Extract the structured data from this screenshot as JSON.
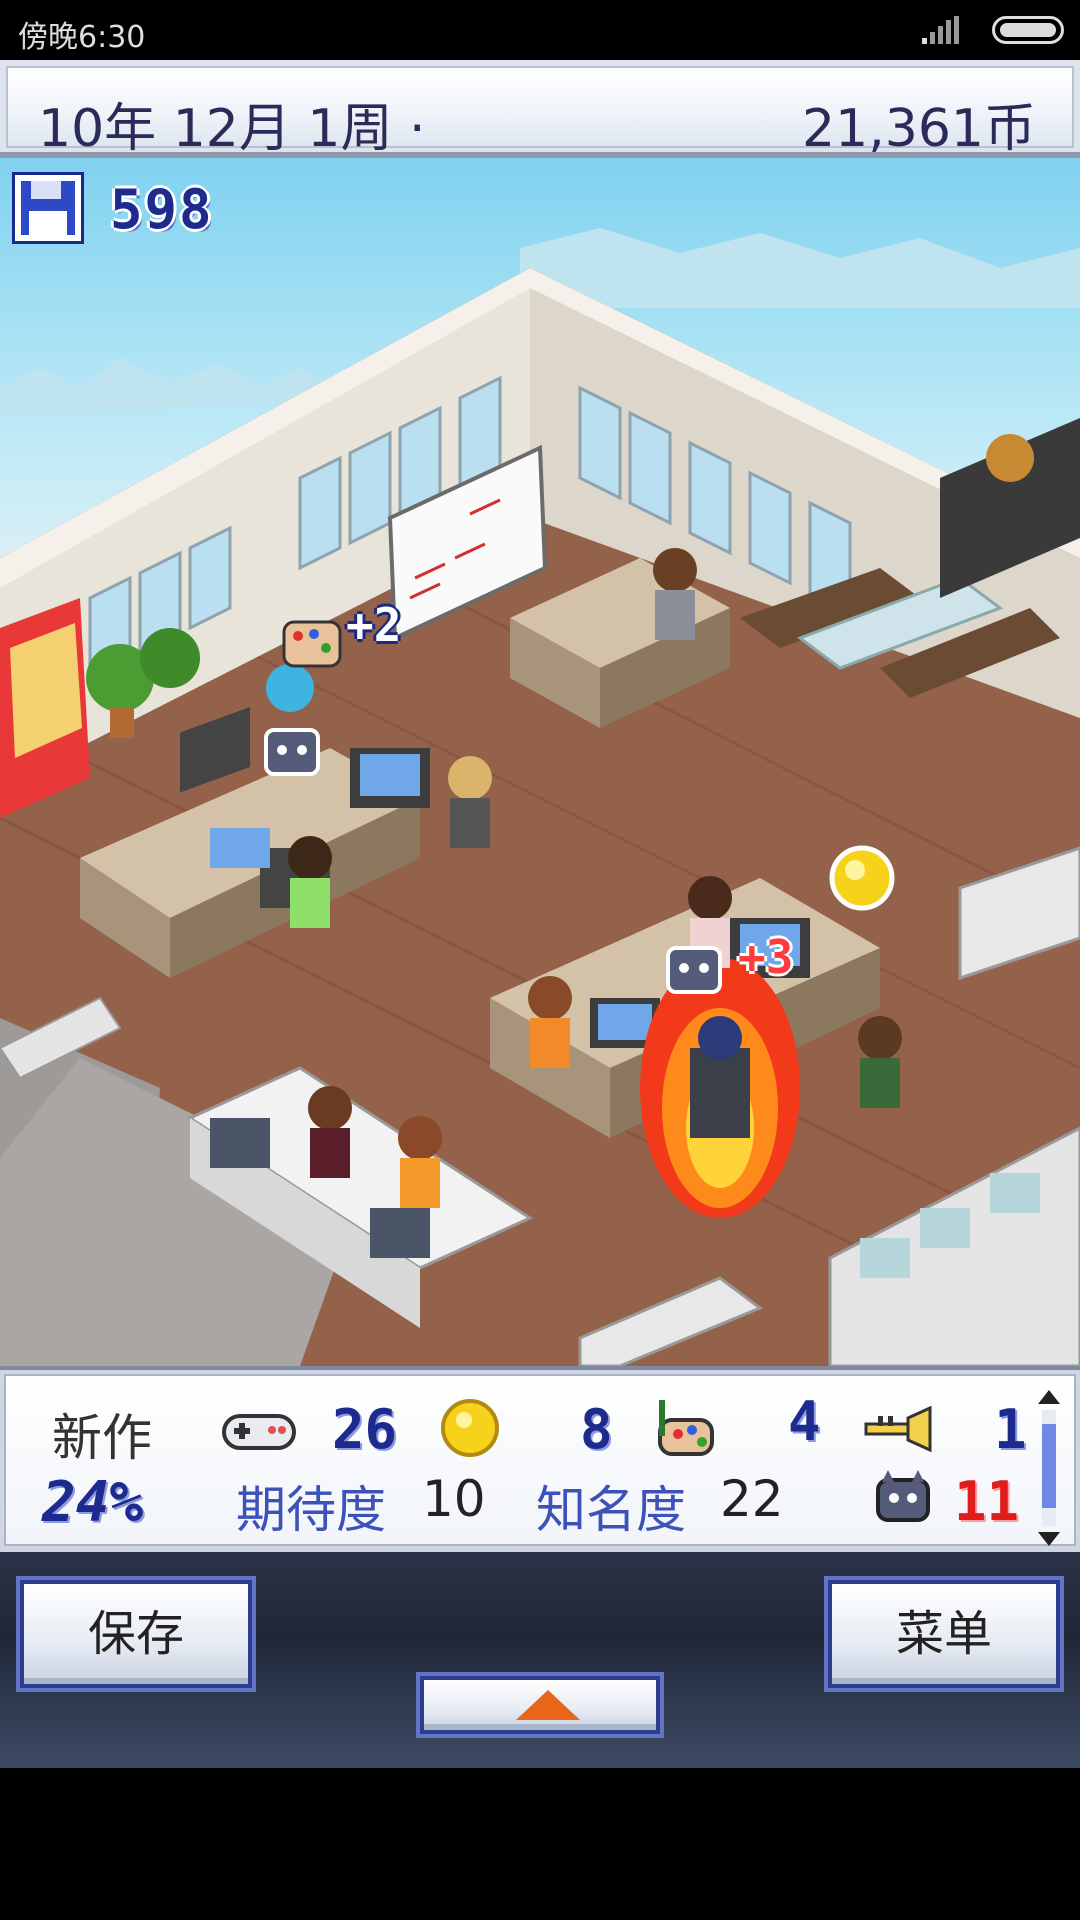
{
  "status_bar": {
    "time": "傍晚6:30"
  },
  "top_bar": {
    "date": "10年 12月 1周 ·",
    "money": "21,361币"
  },
  "scene": {
    "disk_count": "598",
    "float_plus_2": "+2",
    "float_plus_3": "+3"
  },
  "stats": {
    "new_work_label": "新作",
    "progress_percent": "24%",
    "fun_value": "26",
    "coin_value": "8",
    "graphics_value": "4",
    "sound_value": "1",
    "bugs_value": "11",
    "expectation_label": "期待度",
    "expectation_value": "10",
    "fame_label": "知名度",
    "fame_value": "22"
  },
  "controls": {
    "save_label": "保存",
    "menu_label": "菜单"
  },
  "icons": [
    "save-disk-icon",
    "gamepad-icon",
    "gold-coin-icon",
    "paint-palette-icon",
    "trumpet-icon",
    "bug-monster-icon",
    "up-arrow-icon"
  ],
  "colors": {
    "accent_blue": "#1d2b8e",
    "bug_red": "#e01c1c",
    "arrow_orange": "#e8651a"
  }
}
